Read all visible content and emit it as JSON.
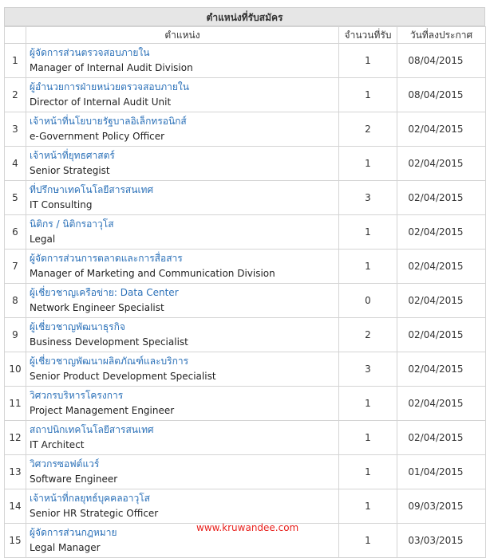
{
  "table": {
    "title": "ตำแหน่งที่รับสมัคร",
    "headers": {
      "position": "ตำแหน่ง",
      "count": "จำนวนที่รับ",
      "date": "วันที่ลงประกาศ"
    },
    "rows": [
      {
        "num": "1",
        "th": "ผู้จัดการส่วนตรวจสอบภายใน",
        "en": "Manager of Internal Audit Division",
        "count": "1",
        "date": "08/04/2015"
      },
      {
        "num": "2",
        "th": "ผู้อำนวยการฝ่ายหน่วยตรวจสอบภายใน",
        "en": "Director of Internal Audit Unit",
        "count": "1",
        "date": "08/04/2015"
      },
      {
        "num": "3",
        "th": "เจ้าหน้าที่นโยบายรัฐบาลอิเล็กทรอนิกส์",
        "en": "e-Government Policy Officer",
        "count": "2",
        "date": "02/04/2015"
      },
      {
        "num": "4",
        "th": "เจ้าหน้าที่ยุทธศาสตร์",
        "en": "Senior Strategist",
        "count": "1",
        "date": "02/04/2015"
      },
      {
        "num": "5",
        "th": "ที่ปรึกษาเทคโนโลยีสารสนเทศ",
        "en": "IT Consulting",
        "count": "3",
        "date": "02/04/2015"
      },
      {
        "num": "6",
        "th": "นิติกร / นิติกรอาวุโส",
        "en": "Legal",
        "count": "1",
        "date": "02/04/2015"
      },
      {
        "num": "7",
        "th": "ผู้จัดการส่วนการตลาดและการสื่อสาร",
        "en": "Manager of Marketing and Communication Division",
        "count": "1",
        "date": "02/04/2015"
      },
      {
        "num": "8",
        "th": "ผู้เชี่ยวชาญเครือข่าย: Data Center",
        "en": "Network Engineer Specialist",
        "count": "0",
        "date": "02/04/2015"
      },
      {
        "num": "9",
        "th": "ผู้เชี่ยวชาญพัฒนาธุรกิจ",
        "en": "Business Development Specialist",
        "count": "2",
        "date": "02/04/2015"
      },
      {
        "num": "10",
        "th": "ผู้เชี่ยวชาญพัฒนาผลิตภัณฑ์และบริการ",
        "en": "Senior Product Development Specialist",
        "count": "3",
        "date": "02/04/2015"
      },
      {
        "num": "11",
        "th": "วิศวกรบริหารโครงการ",
        "en": "Project Management Engineer",
        "count": "1",
        "date": "02/04/2015"
      },
      {
        "num": "12",
        "th": "สถาปนิกเทคโนโลยีสารสนเทศ",
        "en": "IT Architect",
        "count": "1",
        "date": "02/04/2015"
      },
      {
        "num": "13",
        "th": "วิศวกรซอฟต์แวร์",
        "en": "Software Engineer",
        "count": "1",
        "date": "01/04/2015"
      },
      {
        "num": "14",
        "th": "เจ้าหน้าที่กลยุทธ์บุคคลอาวุโส",
        "en": "Senior HR Strategic Officer",
        "count": "1",
        "date": "09/03/2015"
      },
      {
        "num": "15",
        "th": "ผู้จัดการส่วนกฎหมาย",
        "en": "Legal Manager",
        "count": "1",
        "date": "03/03/2015"
      }
    ]
  },
  "watermark": "www.kruwandee.com",
  "colors": {
    "link": "#2a70b8",
    "watermark": "#e8211d",
    "header_bg": "#e6e6e6"
  }
}
